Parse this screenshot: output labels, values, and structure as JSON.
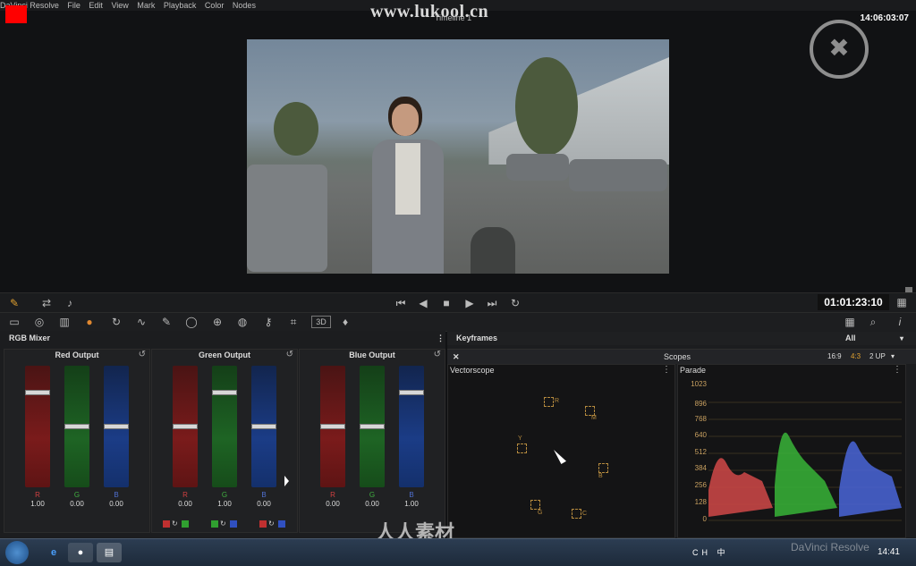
{
  "app": {
    "menu": [
      "DaVinci Resolve",
      "File",
      "Edit",
      "View",
      "Mark",
      "Playback",
      "Color",
      "Nodes"
    ],
    "watermark": "www.lukool.cn",
    "timeline_name": "Timeline 1",
    "clock_timecode": "14:06:03:07",
    "record_timecode": "01:01:23:10",
    "bottom_watermark": "人人素材",
    "bottom_brand": "DaVinci Resolve"
  },
  "rgb_mixer": {
    "title": "RGB Mixer",
    "groups": [
      {
        "title": "Red Output",
        "labels": [
          "R",
          "G",
          "B"
        ],
        "values": [
          "1.00",
          "0.00",
          "0.00"
        ],
        "levels": [
          1.0,
          0.0,
          0.0
        ]
      },
      {
        "title": "Green Output",
        "labels": [
          "R",
          "G",
          "B"
        ],
        "values": [
          "0.00",
          "1.00",
          "0.00"
        ],
        "levels": [
          0.0,
          1.0,
          0.0
        ]
      },
      {
        "title": "Blue Output",
        "labels": [
          "R",
          "G",
          "B"
        ],
        "values": [
          "0.00",
          "0.00",
          "1.00"
        ],
        "levels": [
          0.0,
          0.0,
          1.0
        ]
      }
    ]
  },
  "keyframes": {
    "title": "Keyframes",
    "filter": "All"
  },
  "scopes": {
    "title": "Scopes",
    "aspect_options": [
      "16:9",
      "4:3"
    ],
    "layout": "2 UP",
    "vectorscope": {
      "title": "Vectorscope",
      "targets": [
        "R",
        "M",
        "B",
        "C",
        "G",
        "Y"
      ]
    },
    "parade": {
      "title": "Parade",
      "scale": [
        "1023",
        "896",
        "768",
        "640",
        "512",
        "384",
        "256",
        "128",
        "0"
      ]
    }
  },
  "taskbar": {
    "time": "14:41",
    "lang": "CH",
    "ime": "中"
  },
  "colors": {
    "accent": "#ff0000",
    "red": "#c03030",
    "green": "#30a030",
    "blue": "#3050c0",
    "target": "#b58a3e"
  }
}
